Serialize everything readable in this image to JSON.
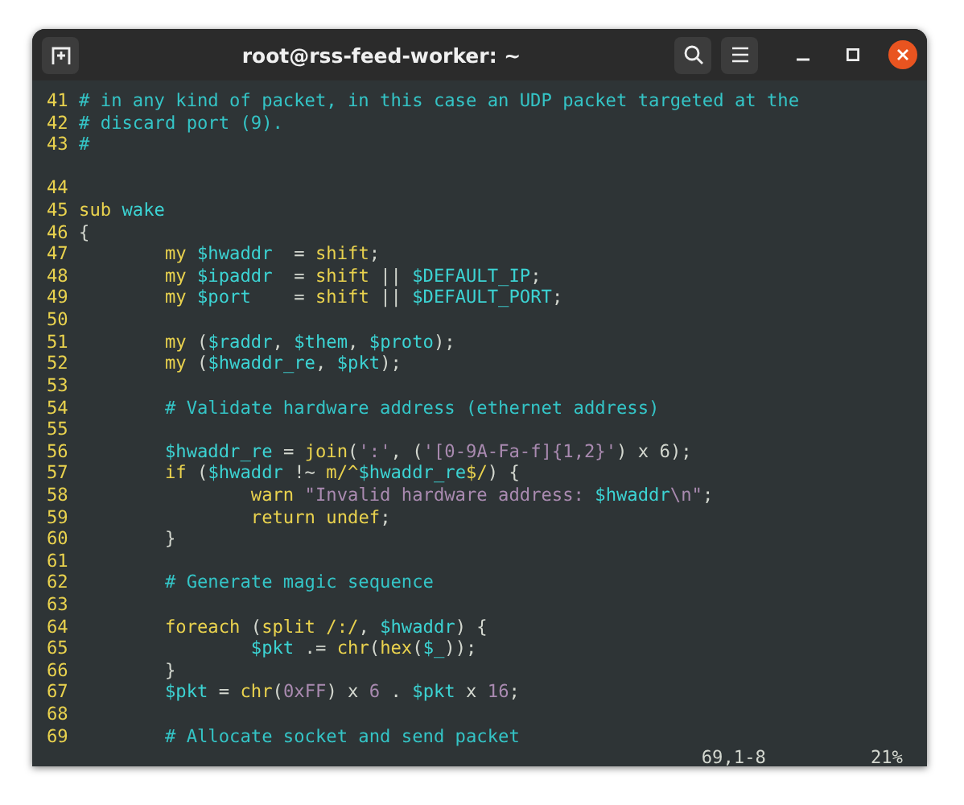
{
  "window": {
    "title": "root@rss-feed-worker: ~"
  },
  "lines": [
    {
      "kind": "code",
      "number": "41",
      "tokens": [
        {
          "kind": "comment",
          "text": "# in any kind of packet, in this case an UDP packet targeted at the"
        }
      ]
    },
    {
      "kind": "code",
      "number": "42",
      "tokens": [
        {
          "kind": "comment",
          "text": "# discard port (9)."
        }
      ]
    },
    {
      "kind": "code",
      "number": "43",
      "tokens": [
        {
          "kind": "comment",
          "text": "#"
        }
      ]
    },
    {
      "kind": "blank"
    },
    {
      "kind": "code",
      "number": "44"
    },
    {
      "kind": "code",
      "number": "45",
      "tokens": [
        {
          "kind": "keyword",
          "text": "sub"
        },
        {
          "kind": "variable",
          "text": " wake"
        }
      ]
    },
    {
      "kind": "code",
      "number": "46",
      "tokens": [
        {
          "kind": "plain",
          "text": "{"
        }
      ]
    },
    {
      "kind": "code",
      "number": "47",
      "tokens": [
        {
          "kind": "keyword",
          "text": "        my"
        },
        {
          "kind": "variable",
          "text": " $hwaddr"
        },
        {
          "kind": "plain",
          "text": "  = "
        },
        {
          "kind": "keyword",
          "text": "shift"
        },
        {
          "kind": "plain",
          "text": ";"
        }
      ]
    },
    {
      "kind": "code",
      "number": "48",
      "tokens": [
        {
          "kind": "keyword",
          "text": "        my"
        },
        {
          "kind": "variable",
          "text": " $ipaddr"
        },
        {
          "kind": "plain",
          "text": "  = "
        },
        {
          "kind": "keyword",
          "text": "shift"
        },
        {
          "kind": "plain",
          "text": " || "
        },
        {
          "kind": "variable",
          "text": "$DEFAULT_IP"
        },
        {
          "kind": "plain",
          "text": ";"
        }
      ]
    },
    {
      "kind": "code",
      "number": "49",
      "tokens": [
        {
          "kind": "keyword",
          "text": "        my"
        },
        {
          "kind": "variable",
          "text": " $port"
        },
        {
          "kind": "plain",
          "text": "    = "
        },
        {
          "kind": "keyword",
          "text": "shift"
        },
        {
          "kind": "plain",
          "text": " || "
        },
        {
          "kind": "variable",
          "text": "$DEFAULT_PORT"
        },
        {
          "kind": "plain",
          "text": ";"
        }
      ]
    },
    {
      "kind": "code",
      "number": "50"
    },
    {
      "kind": "code",
      "number": "51",
      "tokens": [
        {
          "kind": "keyword",
          "text": "        my"
        },
        {
          "kind": "plain",
          "text": " ("
        },
        {
          "kind": "variable",
          "text": "$raddr"
        },
        {
          "kind": "plain",
          "text": ", "
        },
        {
          "kind": "variable",
          "text": "$them"
        },
        {
          "kind": "plain",
          "text": ", "
        },
        {
          "kind": "variable",
          "text": "$proto"
        },
        {
          "kind": "plain",
          "text": ");"
        }
      ]
    },
    {
      "kind": "code",
      "number": "52",
      "tokens": [
        {
          "kind": "keyword",
          "text": "        my"
        },
        {
          "kind": "plain",
          "text": " ("
        },
        {
          "kind": "variable",
          "text": "$hwaddr_re"
        },
        {
          "kind": "plain",
          "text": ", "
        },
        {
          "kind": "variable",
          "text": "$pkt"
        },
        {
          "kind": "plain",
          "text": ");"
        }
      ]
    },
    {
      "kind": "code",
      "number": "53"
    },
    {
      "kind": "code",
      "number": "54",
      "tokens": [
        {
          "kind": "comment",
          "text": "        # Validate hardware address (ethernet address)"
        }
      ]
    },
    {
      "kind": "code",
      "number": "55"
    },
    {
      "kind": "code",
      "number": "56",
      "tokens": [
        {
          "kind": "variable",
          "text": "        $hwaddr_re"
        },
        {
          "kind": "plain",
          "text": " = "
        },
        {
          "kind": "keyword",
          "text": "join"
        },
        {
          "kind": "plain",
          "text": "("
        },
        {
          "kind": "string",
          "text": "':'"
        },
        {
          "kind": "plain",
          "text": ", ("
        },
        {
          "kind": "string",
          "text": "'[0-9A-Fa-f]{1,2}'"
        },
        {
          "kind": "plain",
          "text": ") x 6);"
        }
      ]
    },
    {
      "kind": "code",
      "number": "57",
      "tokens": [
        {
          "kind": "keyword",
          "text": "        if"
        },
        {
          "kind": "plain",
          "text": " ("
        },
        {
          "kind": "variable",
          "text": "$hwaddr"
        },
        {
          "kind": "plain",
          "text": " !~ "
        },
        {
          "kind": "keyword",
          "text": "m/^"
        },
        {
          "kind": "variable",
          "text": "$hwaddr_re"
        },
        {
          "kind": "keyword",
          "text": "$/"
        },
        {
          "kind": "plain",
          "text": ") {"
        }
      ]
    },
    {
      "kind": "code",
      "number": "58",
      "tokens": [
        {
          "kind": "keyword",
          "text": "                warn"
        },
        {
          "kind": "string",
          "text": " \"Invalid hardware address: "
        },
        {
          "kind": "variable",
          "text": "$hwaddr"
        },
        {
          "kind": "string",
          "text": "\\n\""
        },
        {
          "kind": "plain",
          "text": ";"
        }
      ]
    },
    {
      "kind": "code",
      "number": "59",
      "tokens": [
        {
          "kind": "keyword",
          "text": "                return"
        },
        {
          "kind": "keyword",
          "text": " undef"
        },
        {
          "kind": "plain",
          "text": ";"
        }
      ]
    },
    {
      "kind": "code",
      "number": "60",
      "tokens": [
        {
          "kind": "plain",
          "text": "        }"
        }
      ]
    },
    {
      "kind": "code",
      "number": "61"
    },
    {
      "kind": "code",
      "number": "62",
      "tokens": [
        {
          "kind": "comment",
          "text": "        # Generate magic sequence"
        }
      ]
    },
    {
      "kind": "code",
      "number": "63"
    },
    {
      "kind": "code",
      "number": "64",
      "tokens": [
        {
          "kind": "keyword",
          "text": "        foreach"
        },
        {
          "kind": "plain",
          "text": " ("
        },
        {
          "kind": "keyword",
          "text": "split"
        },
        {
          "kind": "keyword",
          "text": " /:/"
        },
        {
          "kind": "plain",
          "text": ", "
        },
        {
          "kind": "variable",
          "text": "$hwaddr"
        },
        {
          "kind": "plain",
          "text": ") {"
        }
      ]
    },
    {
      "kind": "code",
      "number": "65",
      "tokens": [
        {
          "kind": "variable",
          "text": "                $pkt"
        },
        {
          "kind": "plain",
          "text": " .= "
        },
        {
          "kind": "keyword",
          "text": "chr"
        },
        {
          "kind": "plain",
          "text": "("
        },
        {
          "kind": "keyword",
          "text": "hex"
        },
        {
          "kind": "plain",
          "text": "("
        },
        {
          "kind": "variable",
          "text": "$_"
        },
        {
          "kind": "plain",
          "text": "));"
        }
      ]
    },
    {
      "kind": "code",
      "number": "66",
      "tokens": [
        {
          "kind": "plain",
          "text": "        }"
        }
      ]
    },
    {
      "kind": "code",
      "number": "67",
      "tokens": [
        {
          "kind": "variable",
          "text": "        $pkt"
        },
        {
          "kind": "plain",
          "text": " = "
        },
        {
          "kind": "keyword",
          "text": "chr"
        },
        {
          "kind": "plain",
          "text": "("
        },
        {
          "kind": "string",
          "text": "0xFF"
        },
        {
          "kind": "plain",
          "text": ") x "
        },
        {
          "kind": "string",
          "text": "6"
        },
        {
          "kind": "plain",
          "text": " . "
        },
        {
          "kind": "variable",
          "text": "$pkt"
        },
        {
          "kind": "plain",
          "text": " x "
        },
        {
          "kind": "string",
          "text": "16"
        },
        {
          "kind": "plain",
          "text": ";"
        }
      ]
    },
    {
      "kind": "code",
      "number": "68"
    },
    {
      "kind": "code",
      "number": "69",
      "tokens": [
        {
          "kind": "comment",
          "text": "        # Allocate socket and send packet"
        }
      ]
    }
  ],
  "status_bar": {
    "position": "69,1-8",
    "scroll": "21%"
  }
}
